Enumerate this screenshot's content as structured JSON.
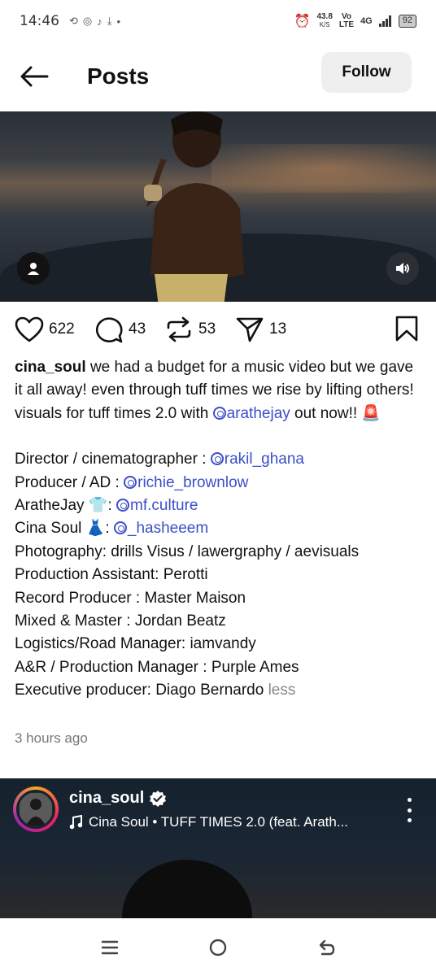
{
  "status_bar": {
    "time": "14:46",
    "net_speed_value": "43.8",
    "net_speed_unit": "K/S",
    "volte_top": "Vo",
    "volte_bottom": "LTE",
    "network": "4G",
    "battery": "92"
  },
  "header": {
    "title": "Posts",
    "follow_label": "Follow"
  },
  "actions": {
    "likes": "622",
    "comments": "43",
    "reposts": "53",
    "shares": "13"
  },
  "caption": {
    "username": "cina_soul",
    "text": "we had a budget for a music video but we gave it all away! even through tuff times we rise by lifting others! visuals for tuff times 2.0 with",
    "mention": "arathejay",
    "text_after": "out now!! 🚨",
    "credits": [
      {
        "label": "Director / cinematographer : ",
        "mention": "rakil_ghana"
      },
      {
        "label": "Producer / AD : ",
        "mention": "richie_brownlow"
      },
      {
        "label": "AratheJay 👕: ",
        "mention": "mf.culture"
      },
      {
        "label": "Cina Soul 👗: ",
        "mention": "_hasheeem"
      },
      {
        "label": "Photography: drills Visus / lawergraphy / aevisuals",
        "mention": ""
      },
      {
        "label": "Production Assistant: Perotti",
        "mention": ""
      },
      {
        "label": "Record Producer : Master Maison",
        "mention": ""
      },
      {
        "label": "Mixed & Master : Jordan Beatz",
        "mention": ""
      },
      {
        "label": "Logistics/Road Manager: iamvandy",
        "mention": ""
      },
      {
        "label": "A&R / Production Manager : Purple Ames",
        "mention": ""
      },
      {
        "label": "Executive producer: Diago Bernardo",
        "mention": ""
      }
    ],
    "less_label": "less",
    "time_ago": "3 hours ago"
  },
  "next_post": {
    "username": "cina_soul",
    "music": "Cina Soul • TUFF TIMES 2.0 (feat. Arath..."
  },
  "icons": {
    "back": "arrow-left-icon",
    "user_tag": "user-icon",
    "volume": "volume-icon",
    "like": "heart-icon",
    "comment": "comment-icon",
    "repost": "repost-icon",
    "share": "send-icon",
    "bookmark": "bookmark-icon",
    "verified": "verified-icon",
    "music": "music-note-icon",
    "more": "more-vertical-icon"
  },
  "colors": {
    "mention": "#3b4fc9",
    "follow_bg": "#efefef",
    "time_ago": "#777777"
  }
}
